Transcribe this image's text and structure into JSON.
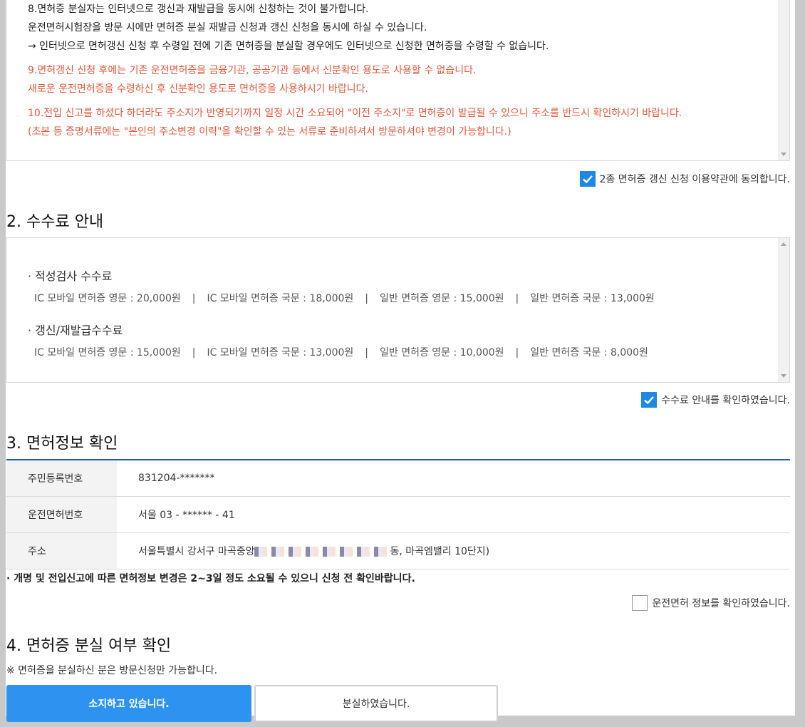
{
  "terms": {
    "lines": [
      "8.면허증 분실자는 인터넷으로 갱신과 재발급을 동시에 신청하는 것이 불가합니다.",
      "운전면허시험장을 방문 시에만 면허증 분실 재발급 신청과 갱신 신청을 동시에 하실 수 있습니다.",
      "→ 인터넷으로 면허갱신 신청 후 수령일 전에 기존 면허증을 분실할 경우에도 인터넷으로 신청한 면허증을 수령할 수 없습니다.",
      "9.면허갱신 신청 후에는 기존 운전면허증을 금융기관, 공공기관 등에서 신분확인 용도로 사용할 수 없습니다.",
      "새로운 운전면허증을 수령하신 후 신분확인 용도로 면허증을 사용하시기 바랍니다.",
      "10.전입 신고를 하셨다 하더라도 주소지가 반영되기까지 일정 시간 소요되어 \"이전 주소지\"로 면허증이 발급될 수 있으니 주소를 반드시 확인하시기 바랍니다.",
      "(초본 등 증명서류에는 \"본인의 주소변경 이력\"을 확인할 수 있는 서류로 준비하셔서 방문하셔야 변경이 가능합니다.)"
    ],
    "agree_label": "2종 면허증 갱신 신청 이용약관에 동의합니다."
  },
  "fee": {
    "title": "2. 수수료 안내",
    "aptitude_label": "· 적성검사 수수료",
    "aptitude_items": [
      "IC 모바일 면허증 영문 : 20,000원",
      "IC 모바일 면허증 국문 : 18,000원",
      "일반 면허증 영문 : 15,000원",
      "일반 면허증 국문 : 13,000원"
    ],
    "renewal_label": "· 갱신/재발급수수료",
    "renewal_items": [
      "IC 모바일 면허증 영문 : 15,000원",
      "IC 모바일 면허증 국문 : 13,000원",
      "일반 면허증 영문 : 10,000원",
      "일반 면허증 국문 : 8,000원"
    ],
    "separator": "|",
    "confirm_label": "수수료 안내를 확인하였습니다."
  },
  "license": {
    "title": "3. 면허정보 확인",
    "rows": [
      {
        "label": "주민등록번호",
        "value": "831204-*******"
      },
      {
        "label": "운전면허번호",
        "value": "서울 03 - ****** - 41"
      },
      {
        "label": "주소",
        "value_prefix": "서울특별시 강서구 마곡중앙",
        "value_suffix": "동, 마곡엠밸리 10단지)"
      }
    ],
    "notice": "· 개명 및 전입신고에 따른 면허정보 변경은 2~3일 정도 소요될 수 있으니 신청 전 확인바랍니다.",
    "confirm_label": "운전면허 정보를 확인하였습니다."
  },
  "loss": {
    "title": "4. 면허증 분실 여부 확인",
    "note": "※ 면허증을 분실하신 분은 방문신청만 가능합니다.",
    "have_button": "소지하고 있습니다.",
    "lost_button": "분실하였습니다."
  },
  "colors": {
    "accent": "#2e92f0",
    "checkbox": "#1e88e5",
    "warning_text": "#e2583a",
    "table_border": "#1a5aa8"
  }
}
